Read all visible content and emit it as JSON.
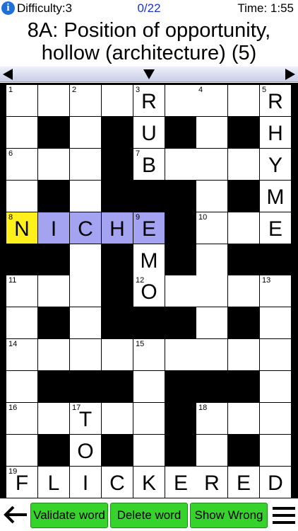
{
  "status": {
    "info_icon": "i",
    "difficulty": "Difficulty:3",
    "progress": "0/22",
    "time": "Time: 1:55"
  },
  "clue": {
    "line1": "8A: Position of opportunity,",
    "line2": "hollow (architecture) (5)"
  },
  "nav": {
    "left_icon": "triangle-left-icon",
    "down_icon": "triangle-down-icon",
    "right_icon": "triangle-right-icon"
  },
  "colors": {
    "current_cell": "#ffef1a",
    "selected_word": "#a3a3f2",
    "button": "#36d32d",
    "progress_text": "#1a33cc"
  },
  "grid": {
    "rows": 13,
    "cols": 9,
    "blocks": [
      [
        1,
        1
      ],
      [
        1,
        3
      ],
      [
        1,
        5
      ],
      [
        1,
        7
      ],
      [
        2,
        3
      ],
      [
        3,
        1
      ],
      [
        3,
        3
      ],
      [
        3,
        4
      ],
      [
        3,
        5
      ],
      [
        3,
        7
      ],
      [
        4,
        5
      ],
      [
        5,
        0
      ],
      [
        5,
        1
      ],
      [
        5,
        3
      ],
      [
        5,
        5
      ],
      [
        5,
        7
      ],
      [
        5,
        8
      ],
      [
        6,
        3
      ],
      [
        7,
        1
      ],
      [
        7,
        3
      ],
      [
        7,
        4
      ],
      [
        7,
        5
      ],
      [
        7,
        7
      ],
      [
        9,
        1
      ],
      [
        9,
        2
      ],
      [
        9,
        3
      ],
      [
        9,
        5
      ],
      [
        9,
        6
      ],
      [
        9,
        7
      ],
      [
        10,
        5
      ],
      [
        11,
        1
      ],
      [
        11,
        3
      ],
      [
        11,
        5
      ],
      [
        11,
        7
      ]
    ],
    "numbers": [
      [
        0,
        0,
        "1"
      ],
      [
        0,
        2,
        "2"
      ],
      [
        0,
        4,
        "3"
      ],
      [
        0,
        6,
        "4"
      ],
      [
        0,
        8,
        "5"
      ],
      [
        2,
        0,
        "6"
      ],
      [
        2,
        4,
        "7"
      ],
      [
        4,
        0,
        "8"
      ],
      [
        4,
        4,
        "9"
      ],
      [
        4,
        6,
        "10"
      ],
      [
        6,
        0,
        "11"
      ],
      [
        6,
        4,
        "12"
      ],
      [
        6,
        8,
        "13"
      ],
      [
        8,
        0,
        "14"
      ],
      [
        8,
        4,
        "15"
      ],
      [
        10,
        0,
        "16"
      ],
      [
        10,
        2,
        "17"
      ],
      [
        10,
        6,
        "18"
      ],
      [
        12,
        0,
        "19"
      ]
    ],
    "letters": [
      [
        0,
        4,
        "R"
      ],
      [
        0,
        8,
        "R"
      ],
      [
        1,
        4,
        "U"
      ],
      [
        1,
        8,
        "H"
      ],
      [
        2,
        4,
        "B"
      ],
      [
        2,
        8,
        "Y"
      ],
      [
        3,
        8,
        "M"
      ],
      [
        4,
        0,
        "N"
      ],
      [
        4,
        1,
        "I"
      ],
      [
        4,
        2,
        "C"
      ],
      [
        4,
        3,
        "H"
      ],
      [
        4,
        4,
        "E"
      ],
      [
        4,
        8,
        "E"
      ],
      [
        5,
        4,
        "M"
      ],
      [
        6,
        4,
        "O"
      ],
      [
        10,
        2,
        "T"
      ],
      [
        11,
        2,
        "O"
      ],
      [
        12,
        0,
        "F"
      ],
      [
        12,
        1,
        "L"
      ],
      [
        12,
        2,
        "I"
      ],
      [
        12,
        3,
        "C"
      ],
      [
        12,
        4,
        "K"
      ],
      [
        12,
        5,
        "E"
      ],
      [
        12,
        6,
        "R"
      ],
      [
        12,
        7,
        "E"
      ],
      [
        12,
        8,
        "D"
      ]
    ],
    "current": [
      4,
      0
    ],
    "word": [
      [
        4,
        1
      ],
      [
        4,
        2
      ],
      [
        4,
        3
      ],
      [
        4,
        4
      ]
    ]
  },
  "toolbar": {
    "back_icon": "arrow-left-icon",
    "validate_label": "Validate word",
    "delete_label": "Delete word",
    "show_wrong_label": "Show Wrong",
    "menu_icon": "hamburger-menu-icon"
  }
}
